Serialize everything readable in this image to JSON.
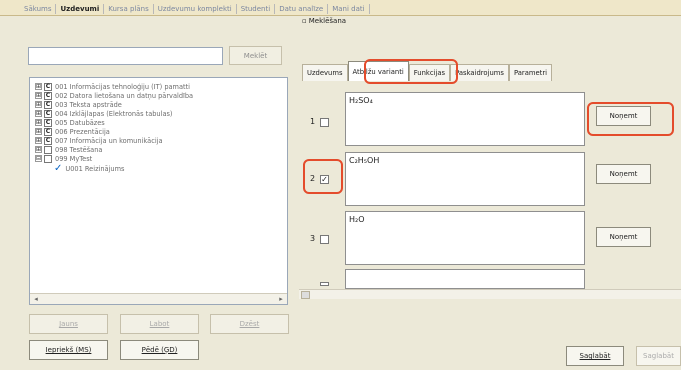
{
  "top_tabs": [
    "Sākums",
    "Uzdevumi",
    "Kursa plāns",
    "Uzdevumu komplekti",
    "Studenti",
    "Datu analīze",
    "Mani dati"
  ],
  "search_button": "Meklēt",
  "tree": [
    {
      "expander": "⊞",
      "icon": "C",
      "label": "001 Informācijas tehnoloģiju (IT) pamatti"
    },
    {
      "expander": "⊞",
      "icon": "C",
      "label": "002 Datora lietošana un datņu pārvaldība"
    },
    {
      "expander": "⊞",
      "icon": "C",
      "label": "003 Teksta apstrāde"
    },
    {
      "expander": "⊞",
      "icon": "C",
      "label": "004 Izklājlapas (Elektronās tabulas)"
    },
    {
      "expander": "⊞",
      "icon": "C",
      "label": "005 Datubāzes"
    },
    {
      "expander": "⊞",
      "icon": "C",
      "label": "006 Prezentācija"
    },
    {
      "expander": "⊞",
      "icon": "C",
      "label": "007 Informācija un komunikācija"
    },
    {
      "expander": "⊞",
      "icon": "",
      "label": "098 Testēšana"
    },
    {
      "expander": "⊟",
      "icon": "",
      "label": "099 MyTest"
    },
    {
      "expander": "",
      "icon": "✓",
      "label": "U001 Reizinājums"
    }
  ],
  "left_buttons": {
    "new": "Jauns",
    "edit": "Labot",
    "delete": "Dzēst"
  },
  "left_bottom": {
    "prev": "Iepriekš (MS)",
    "next": "Pēdē (ĢD)"
  },
  "panel_title": "Meklēšana",
  "tabs": [
    "Uzdevums",
    "Atbilžu varianti",
    "Funkcijas",
    "Paskaidrojums",
    "Parametri"
  ],
  "active_tab": 1,
  "variants": [
    {
      "num": "1",
      "checked": false,
      "text": "H₂SO₄",
      "remove": "Noņemt"
    },
    {
      "num": "2",
      "checked": true,
      "text": "C₂H₅OH",
      "remove": "Noņemt"
    },
    {
      "num": "3",
      "checked": false,
      "text": "H₂O",
      "remove": "Noņemt"
    }
  ],
  "bottom_right": {
    "save": "Saglabāt",
    "other": "Saglabāt"
  }
}
